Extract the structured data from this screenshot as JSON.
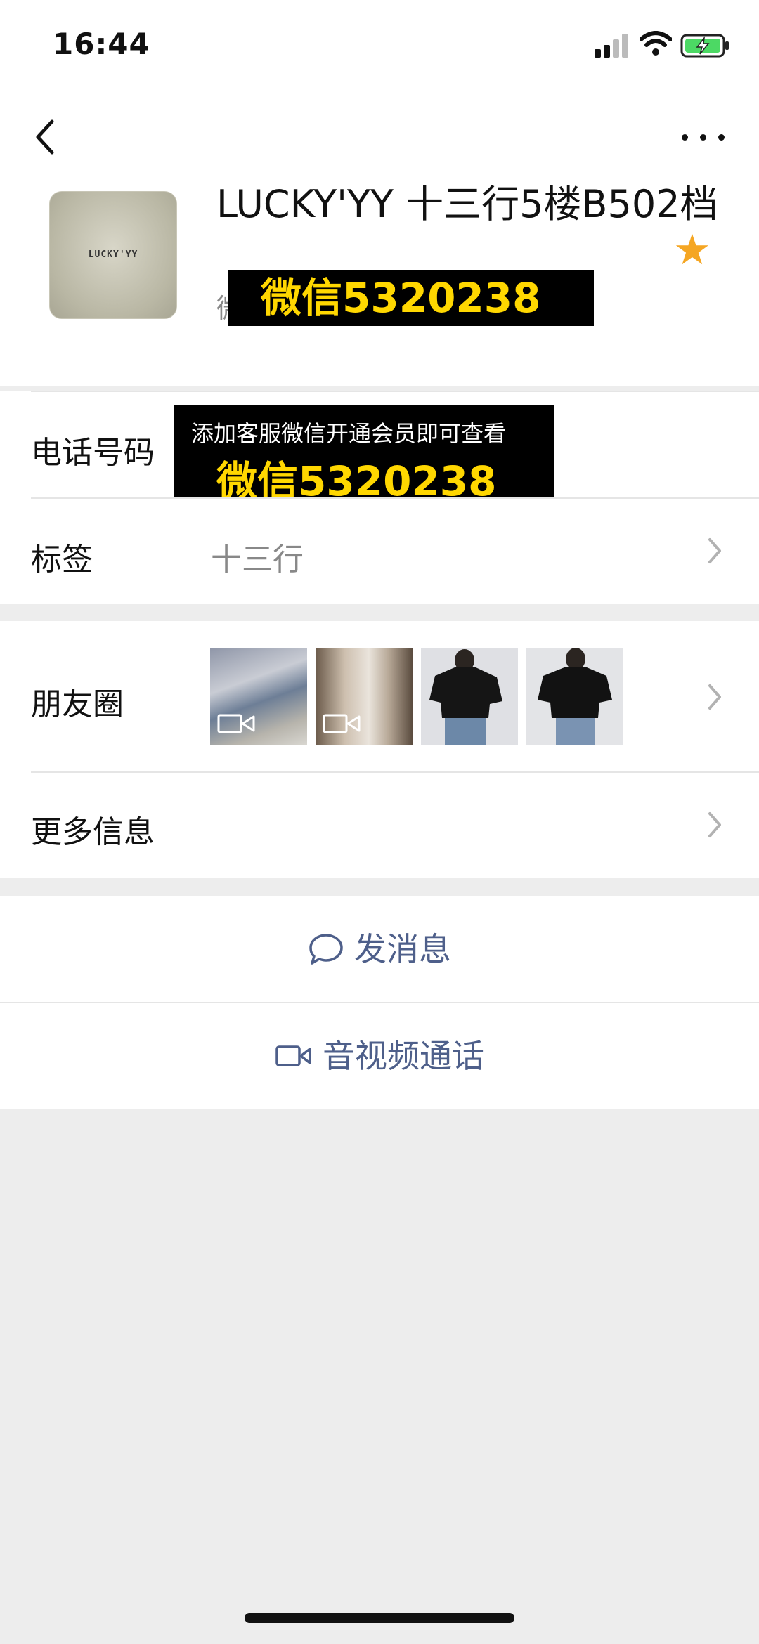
{
  "status_bar": {
    "time": "16:44",
    "signal_icon": "signal-bars-icon",
    "wifi_icon": "wifi-icon",
    "battery_icon": "battery-charging-icon"
  },
  "header": {
    "back_icon": "back-chevron-icon",
    "more_icon": "more-dots-icon",
    "avatar_logo_text": "LUCKY'YY",
    "contact_name": "LUCKY'YY 十三行5楼B502档",
    "star_icon": "star-icon",
    "star_color": "#f5a623",
    "wechat_id_prefix": "微",
    "wechat_overlay": "微信5320238"
  },
  "info": {
    "phone_label": "电话号码",
    "phone_overlay_line1": "添加客服微信开通会员即可查看",
    "phone_overlay_line2": "微信5320238",
    "tags_label": "标签",
    "tags_value": "十三行"
  },
  "moments": {
    "label": "朋友圈",
    "thumbnails": [
      {
        "kind": "video"
      },
      {
        "kind": "video"
      },
      {
        "kind": "photo"
      },
      {
        "kind": "photo"
      }
    ],
    "more_info_label": "更多信息"
  },
  "actions": {
    "message_label": "发消息",
    "message_icon": "chat-bubble-icon",
    "call_label": "音视频通话",
    "call_icon": "video-camera-icon"
  },
  "colors": {
    "accent_link": "#4e5f8a",
    "overlay_text": "#ffd700",
    "background": "#ededed"
  }
}
